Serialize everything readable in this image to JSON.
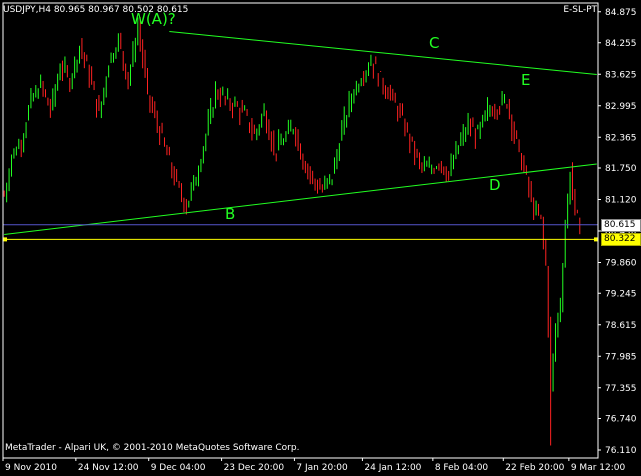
{
  "window": {
    "symbol_header": "USDJPY,H4  80.965 80.967 80.502 80.615",
    "indicator_name": "E-SL-PT",
    "copyright": "MetaTrader - Alpari UK, © 2001-2010 MetaQuotes Software Corp."
  },
  "price_tags": {
    "current": "80.615",
    "level": "80.322"
  },
  "wave_labels": [
    "W(A)?",
    "B",
    "C",
    "D",
    "E"
  ],
  "colors": {
    "background": "#000000",
    "axis": "#ffffff",
    "grid": "#555555",
    "bull_candle": "#22ff22",
    "bear_candle": "#ff2222",
    "trendline": "#22ff22",
    "level_line": "#ffff00",
    "current_line": "#5555cc",
    "annotation": "#22ff22"
  },
  "chart_data": {
    "type": "candlestick",
    "y_ticks": [
      "84.875",
      "84.255",
      "83.625",
      "82.995",
      "82.365",
      "81.750",
      "81.120",
      "80.490",
      "79.860",
      "79.245",
      "78.615",
      "77.985",
      "77.355",
      "76.740",
      "76.110"
    ],
    "x_ticks": [
      "9 Nov 2010",
      "24 Nov 12:00",
      "9 Dec 04:00",
      "23 Dec 20:00",
      "7 Jan 20:00",
      "24 Jan 12:00",
      "8 Feb 04:00",
      "22 Feb 20:00",
      "9 Mar 12:00"
    ],
    "ylim": [
      75.95,
      85.05
    ],
    "last_price": 80.615,
    "horizontal_level": 80.322,
    "close_path": [
      [
        0,
        81.2
      ],
      [
        3,
        82.0
      ],
      [
        7,
        82.3
      ],
      [
        11,
        83.1
      ],
      [
        15,
        83.4
      ],
      [
        19,
        82.9
      ],
      [
        23,
        83.8
      ],
      [
        27,
        83.5
      ],
      [
        31,
        84.2
      ],
      [
        35,
        83.6
      ],
      [
        39,
        82.8
      ],
      [
        43,
        83.9
      ],
      [
        47,
        84.3
      ],
      [
        51,
        83.5
      ],
      [
        55,
        84.6
      ],
      [
        59,
        83.2
      ],
      [
        63,
        82.6
      ],
      [
        67,
        82.0
      ],
      [
        71,
        81.4
      ],
      [
        75,
        81.0
      ],
      [
        79,
        81.6
      ],
      [
        83,
        82.4
      ],
      [
        87,
        83.3
      ],
      [
        91,
        83.1
      ],
      [
        95,
        83.0
      ],
      [
        99,
        82.8
      ],
      [
        103,
        82.4
      ],
      [
        107,
        82.9
      ],
      [
        111,
        82.1
      ],
      [
        115,
        82.3
      ],
      [
        119,
        82.6
      ],
      [
        123,
        81.9
      ],
      [
        127,
        81.5
      ],
      [
        131,
        81.3
      ],
      [
        135,
        81.6
      ],
      [
        139,
        82.5
      ],
      [
        143,
        83.2
      ],
      [
        147,
        83.6
      ],
      [
        151,
        83.9
      ],
      [
        155,
        83.5
      ],
      [
        159,
        83.2
      ],
      [
        163,
        82.8
      ],
      [
        167,
        82.3
      ],
      [
        171,
        81.8
      ],
      [
        175,
        81.7
      ],
      [
        179,
        81.9
      ],
      [
        183,
        81.6
      ],
      [
        187,
        82.2
      ],
      [
        191,
        82.6
      ],
      [
        195,
        82.4
      ],
      [
        199,
        82.9
      ],
      [
        203,
        83.0
      ],
      [
        207,
        83.1
      ],
      [
        210,
        82.4
      ],
      [
        214,
        81.7
      ],
      [
        218,
        80.9
      ],
      [
        221,
        80.7
      ],
      [
        223,
        79.8
      ],
      [
        225,
        77.4
      ],
      [
        227,
        78.5
      ],
      [
        229,
        79.1
      ],
      [
        231,
        80.6
      ],
      [
        233,
        81.7
      ],
      [
        235,
        80.8
      ],
      [
        237,
        80.6
      ]
    ],
    "trendlines": [
      {
        "from": [
          68,
          84.48
        ],
        "to": [
          244,
          83.62
        ]
      },
      {
        "from": [
          0,
          80.42
        ],
        "to": [
          244,
          81.83
        ]
      }
    ]
  }
}
